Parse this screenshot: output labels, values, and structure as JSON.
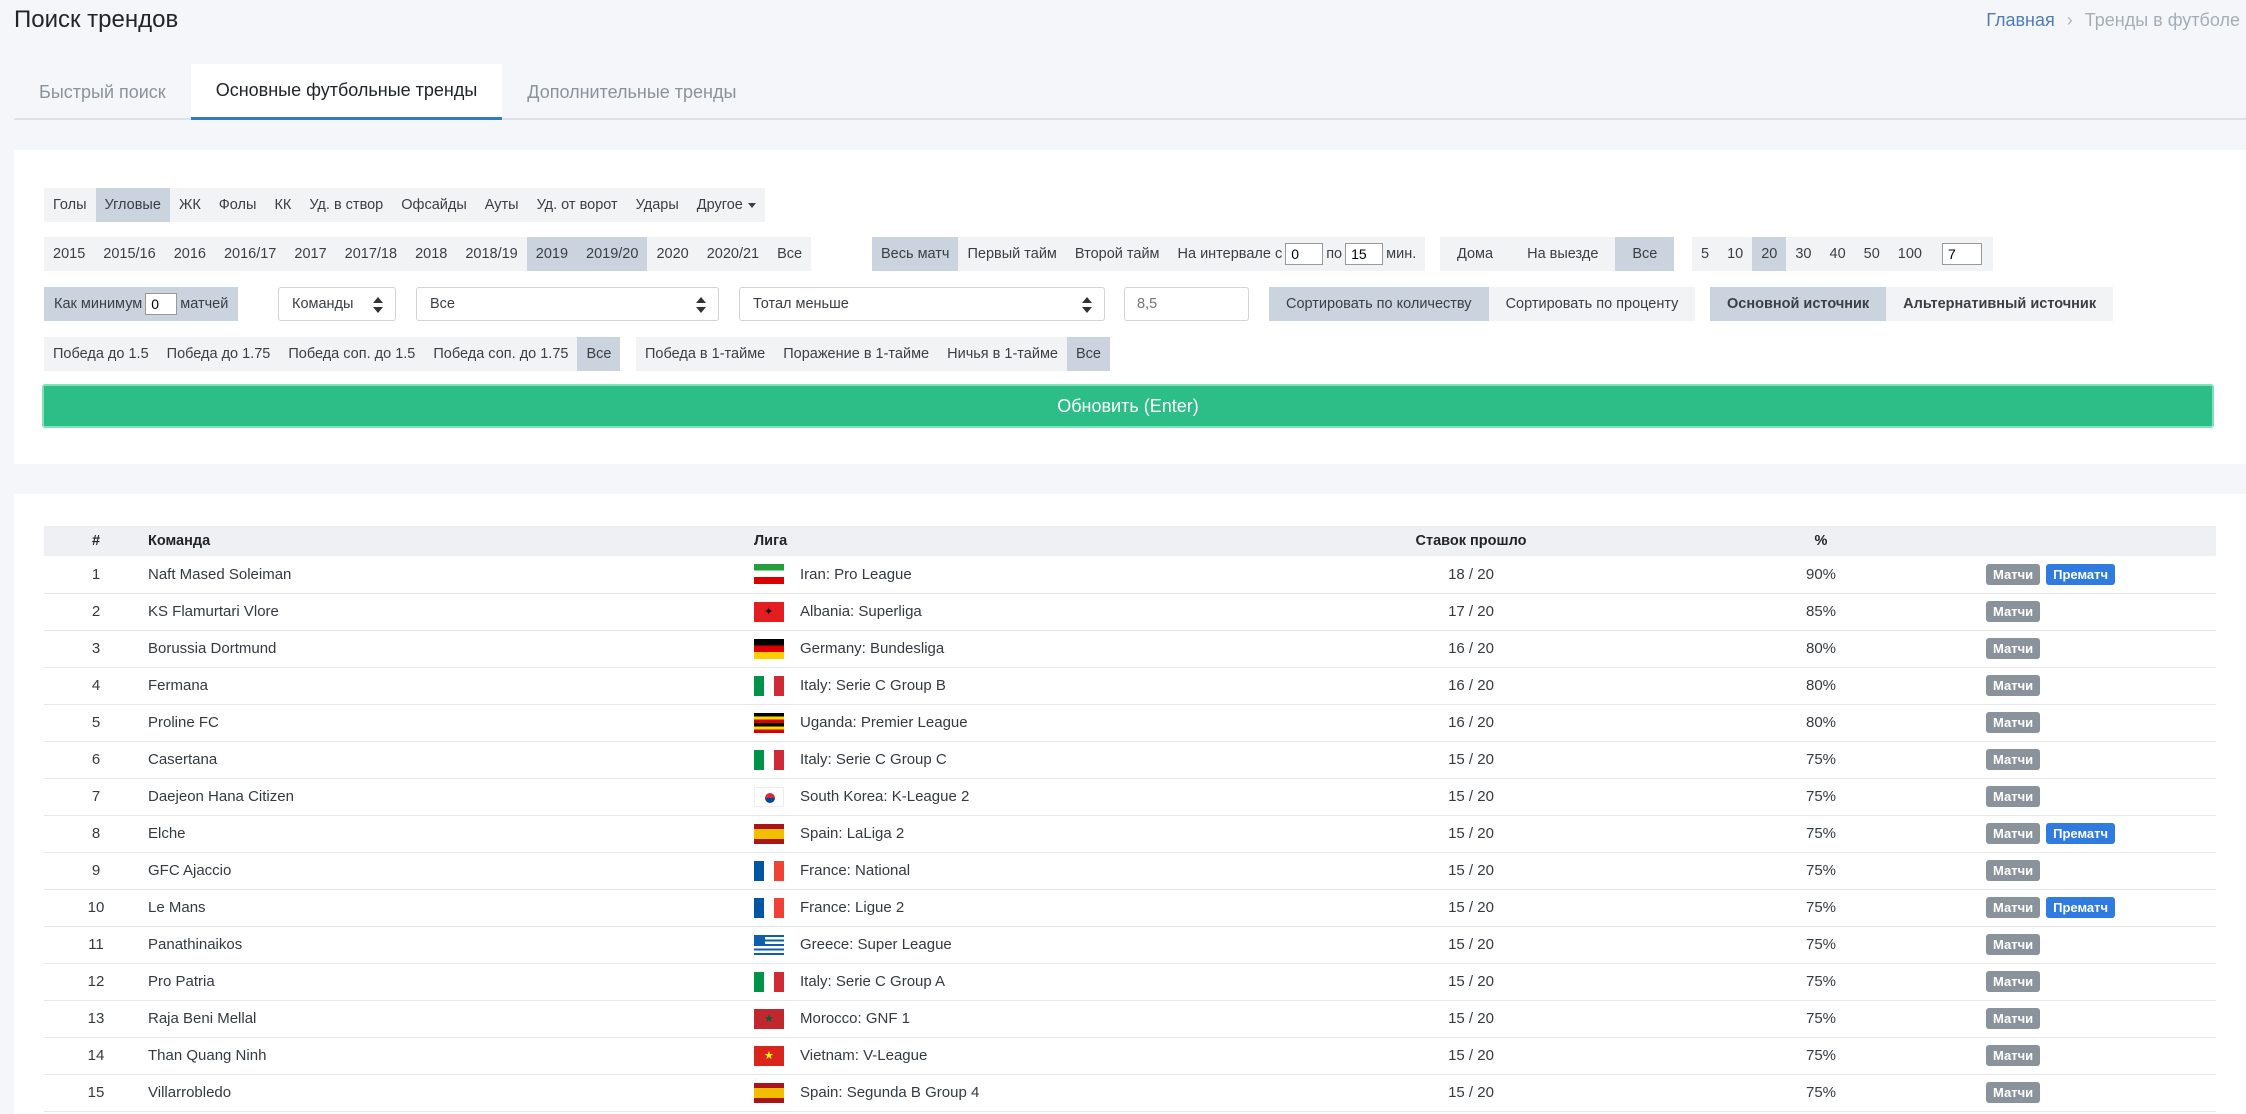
{
  "header": {
    "title": "Поиск трендов",
    "breadcrumb_home": "Главная",
    "breadcrumb_sep": "›",
    "breadcrumb_current": "Тренды в футболе"
  },
  "tabs": [
    "Быстрый поиск",
    "Основные футбольные тренды",
    "Дополнительные тренды"
  ],
  "filters": {
    "stats": [
      "Голы",
      "Угловые",
      "ЖК",
      "Фолы",
      "КК",
      "Уд. в створ",
      "Офсайды",
      "Ауты",
      "Уд. от ворот",
      "Удары"
    ],
    "stats_more": "Другое",
    "seasons": [
      "2015",
      "2015/16",
      "2016",
      "2016/17",
      "2017",
      "2017/18",
      "2018",
      "2018/19",
      "2019",
      "2019/20",
      "2020",
      "2020/21",
      "Все"
    ],
    "periods": [
      "Весь матч",
      "Первый тайм",
      "Второй тайм"
    ],
    "interval_label": "На интервале с",
    "interval_from": "0",
    "interval_to_label": "по",
    "interval_to": "15",
    "interval_unit": "мин.",
    "venue": [
      "Дома",
      "На выезде",
      "Все"
    ],
    "counts": [
      "5",
      "10",
      "20",
      "30",
      "40",
      "50",
      "100"
    ],
    "count_custom": "7",
    "min_label": "Как минимум",
    "min_value": "0",
    "min_unit": "матчей",
    "entity_select": "Команды",
    "scope_select": "Все",
    "bet_type_select": "Тотал меньше",
    "line_placeholder": "8,5",
    "sort": [
      "Сортировать по количеству",
      "Сортировать по проценту"
    ],
    "source": [
      "Основной источник",
      "Альтернативный источник"
    ],
    "handicap": [
      "Победа до 1.5",
      "Победа до 1.75",
      "Победа соп. до 1.5",
      "Победа соп. до 1.75",
      "Все"
    ],
    "first_half": [
      "Победа в 1-тайме",
      "Поражение в 1-тайме",
      "Ничья в 1-тайме",
      "Все"
    ],
    "update_button": "Обновить (Enter)"
  },
  "table": {
    "headers": [
      "#",
      "Команда",
      "Лига",
      "Ставок прошло",
      "%"
    ],
    "matches_label": "Матчи",
    "prematch_label": "Прематч",
    "rows": [
      {
        "n": "1",
        "team": "Naft Mased Soleiman",
        "flag": "iran",
        "league": "Iran: Pro League",
        "bets": "18 / 20",
        "pct": "90%",
        "prematch": true
      },
      {
        "n": "2",
        "team": "KS Flamurtari Vlore",
        "flag": "albania",
        "league": "Albania: Superliga",
        "bets": "17 / 20",
        "pct": "85%",
        "prematch": false
      },
      {
        "n": "3",
        "team": "Borussia Dortmund",
        "flag": "germany",
        "league": "Germany: Bundesliga",
        "bets": "16 / 20",
        "pct": "80%",
        "prematch": false
      },
      {
        "n": "4",
        "team": "Fermana",
        "flag": "italy",
        "league": "Italy: Serie C Group B",
        "bets": "16 / 20",
        "pct": "80%",
        "prematch": false
      },
      {
        "n": "5",
        "team": "Proline FC",
        "flag": "uganda",
        "league": "Uganda: Premier League",
        "bets": "16 / 20",
        "pct": "80%",
        "prematch": false
      },
      {
        "n": "6",
        "team": "Casertana",
        "flag": "italy",
        "league": "Italy: Serie C Group C",
        "bets": "15 / 20",
        "pct": "75%",
        "prematch": false
      },
      {
        "n": "7",
        "team": "Daejeon Hana Citizen",
        "flag": "korea",
        "league": "South Korea: K-League 2",
        "bets": "15 / 20",
        "pct": "75%",
        "prematch": false
      },
      {
        "n": "8",
        "team": "Elche",
        "flag": "spain",
        "league": "Spain: LaLiga 2",
        "bets": "15 / 20",
        "pct": "75%",
        "prematch": true
      },
      {
        "n": "9",
        "team": "GFC Ajaccio",
        "flag": "france",
        "league": "France: National",
        "bets": "15 / 20",
        "pct": "75%",
        "prematch": false
      },
      {
        "n": "10",
        "team": "Le Mans",
        "flag": "france",
        "league": "France: Ligue 2",
        "bets": "15 / 20",
        "pct": "75%",
        "prematch": true
      },
      {
        "n": "11",
        "team": "Panathinaikos",
        "flag": "greece",
        "league": "Greece: Super League",
        "bets": "15 / 20",
        "pct": "75%",
        "prematch": false
      },
      {
        "n": "12",
        "team": "Pro Patria",
        "flag": "italy",
        "league": "Italy: Serie C Group A",
        "bets": "15 / 20",
        "pct": "75%",
        "prematch": false
      },
      {
        "n": "13",
        "team": "Raja Beni Mellal",
        "flag": "morocco",
        "league": "Morocco: GNF 1",
        "bets": "15 / 20",
        "pct": "75%",
        "prematch": false
      },
      {
        "n": "14",
        "team": "Than Quang Ninh",
        "flag": "vietnam",
        "league": "Vietnam: V-League",
        "bets": "15 / 20",
        "pct": "75%",
        "prematch": false
      },
      {
        "n": "15",
        "team": "Villarrobledo",
        "flag": "spain",
        "league": "Spain: Segunda B Group 4",
        "bets": "15 / 20",
        "pct": "75%",
        "prematch": false
      }
    ]
  }
}
